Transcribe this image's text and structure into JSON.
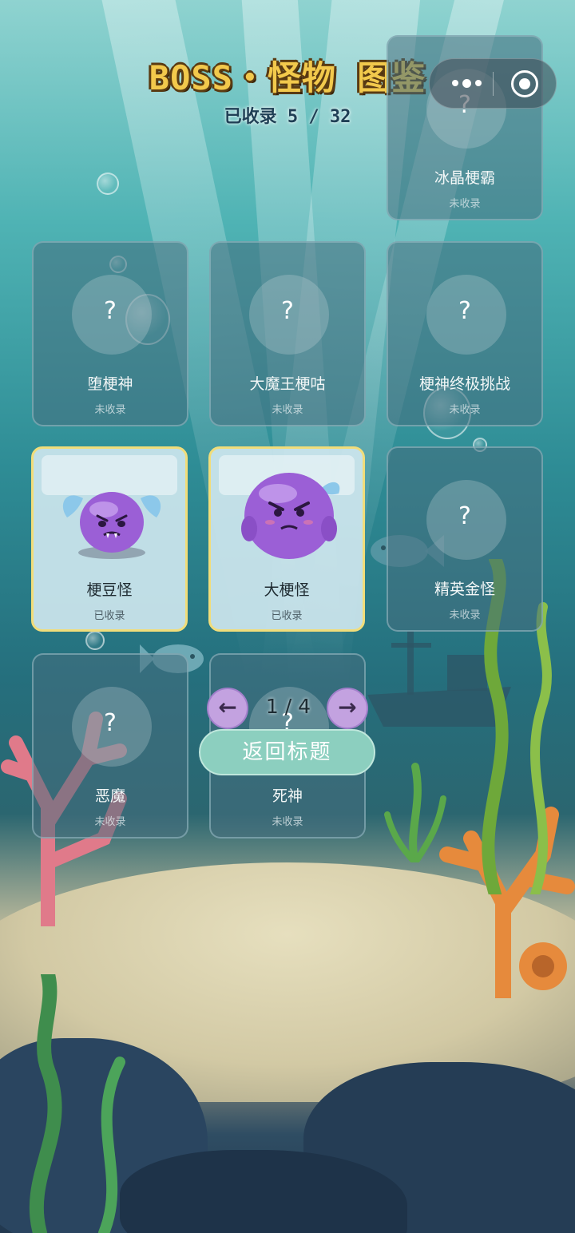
{
  "header": {
    "title": "BOSS・怪物 图鉴",
    "collected_label": "已收录 5 / 32"
  },
  "capsule": {
    "more_icon": "more-dots-icon",
    "close_icon": "target-circle-icon"
  },
  "cards": [
    {
      "name": "冰晶梗霸",
      "status": "未收录",
      "collected": false
    },
    {
      "name": "堕梗神",
      "status": "未收录",
      "collected": false
    },
    {
      "name": "大魔王梗咕",
      "status": "未收录",
      "collected": false
    },
    {
      "name": "梗神终极挑战",
      "status": "未收录",
      "collected": false
    },
    {
      "name": "梗豆怪",
      "status": "已收录",
      "collected": true
    },
    {
      "name": "大梗怪",
      "status": "已收录",
      "collected": true
    },
    {
      "name": "精英金怪",
      "status": "未收录",
      "collected": false
    },
    {
      "name": "恶魔",
      "status": "未收录",
      "collected": false
    },
    {
      "name": "死神",
      "status": "未收录",
      "collected": false
    }
  ],
  "locked_symbol": "?",
  "pager": {
    "prev_label": "←",
    "next_label": "→",
    "page_text": "1 / 4"
  },
  "back_button": "返回标题",
  "colors": {
    "title": "#f2c94c",
    "collected_border": "#f1dd7a",
    "pager_button": "#c3a2e0",
    "back_button": "#8ccfbf"
  }
}
